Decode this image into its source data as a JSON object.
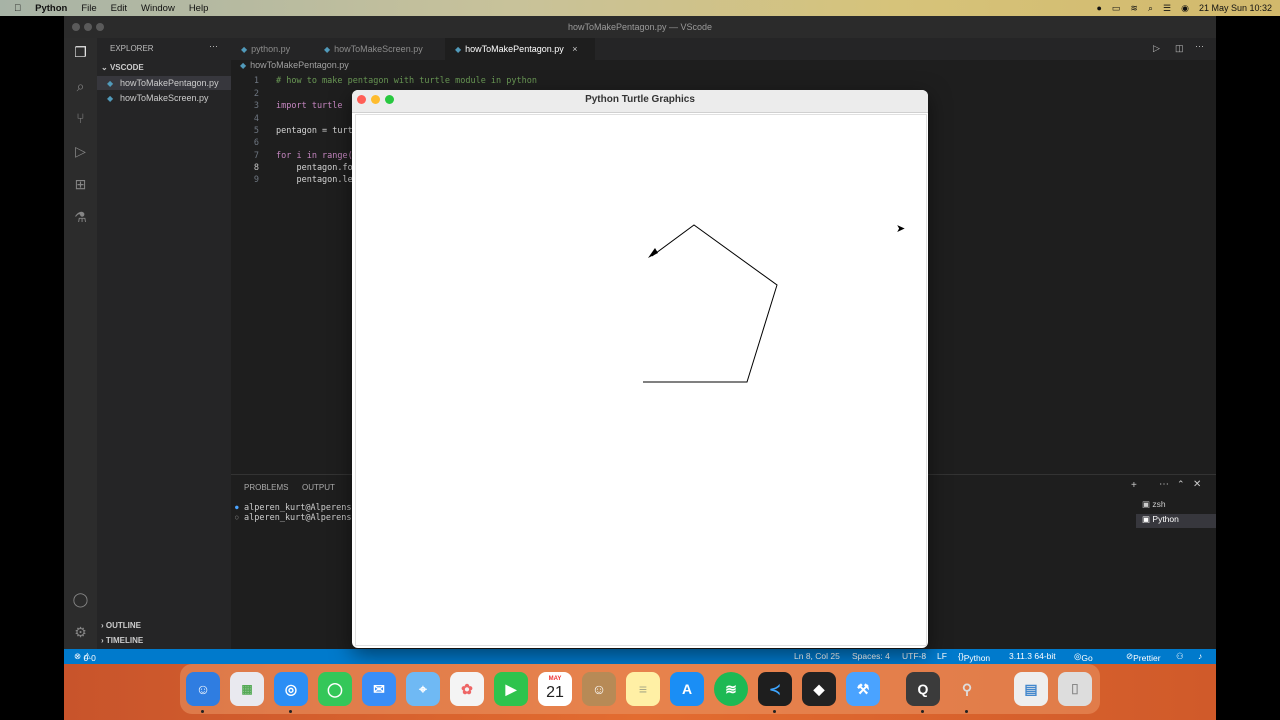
{
  "menubar": {
    "app": "Python",
    "items": [
      "File",
      "Edit",
      "Window",
      "Help"
    ],
    "datetime": "21 May Sun  10:32"
  },
  "vscode": {
    "window_title": "howToMakePentagon.py — VScode",
    "explorer": {
      "header": "EXPLORER",
      "folder": "VSCODE",
      "files": [
        "howToMakePentagon.py",
        "howToMakeScreen.py"
      ],
      "outline": "OUTLINE",
      "timeline": "TIMELINE"
    },
    "tabs": [
      "python.py",
      "howToMakeScreen.py",
      "howToMakePentagon.py"
    ],
    "active_tab_close": "×",
    "breadcrumb": "howToMakePentagon.py",
    "code_lines": [
      {
        "n": "1",
        "text": "# how to make pentagon with turtle module in python",
        "kind": "comment"
      },
      {
        "n": "2",
        "text": "",
        "kind": "plain"
      },
      {
        "n": "3",
        "text": "import turtle",
        "kind": "import"
      },
      {
        "n": "4",
        "text": "",
        "kind": "plain"
      },
      {
        "n": "5",
        "text": "pentagon = turtl",
        "kind": "plain"
      },
      {
        "n": "6",
        "text": "",
        "kind": "plain"
      },
      {
        "n": "7",
        "text": "for i in range(5",
        "kind": "for"
      },
      {
        "n": "8",
        "text": "    pentagon.fo",
        "kind": "plain"
      },
      {
        "n": "9",
        "text": "    pentagon.le",
        "kind": "plain"
      }
    ],
    "panel": {
      "tabs": [
        "PROBLEMS",
        "OUTPUT"
      ],
      "terminal_lines": [
        "alperen_kurt@Alperens-M",
        "alperen_kurt@Alperens-M"
      ],
      "terminals": [
        "zsh",
        "Python"
      ]
    },
    "status": {
      "errors": "0",
      "warnings": "0",
      "position": "Ln 8, Col 25",
      "spaces": "Spaces: 4",
      "encoding": "UTF-8",
      "eol": "LF",
      "language": "Python",
      "interpreter": "3.11.3 64-bit",
      "golive": "Go Live",
      "prettier": "Prettier"
    }
  },
  "turtle_window": {
    "title": "Python Turtle Graphics",
    "drawing": {
      "shape": "pentagon (4 of 5 sides drawn)",
      "line_color": "#000000"
    }
  },
  "dock": {
    "apps": [
      "Finder",
      "Launchpad",
      "Safari",
      "Messages",
      "Mail",
      "Maps",
      "Photos",
      "FaceTime",
      "Calendar",
      "Contacts",
      "Notes",
      "App Store",
      "Spotify",
      "VS Code",
      "DaVinci Resolve",
      "Xcode",
      "QuickTime",
      "Rocket",
      "Preview",
      "Trash"
    ],
    "calendar_month": "MAY",
    "calendar_day": "21"
  }
}
